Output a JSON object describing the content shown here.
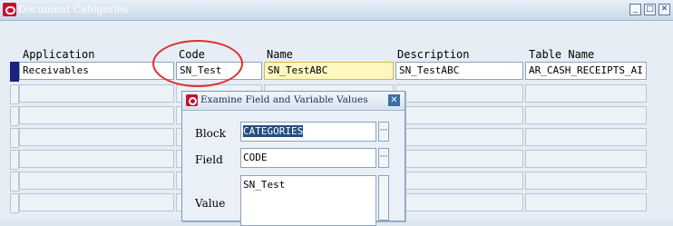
{
  "window": {
    "title": "Document Categories",
    "controls": {
      "minimize": "_",
      "maximize": "□",
      "close": "✕"
    }
  },
  "columns": [
    "Application",
    "Code",
    "Name",
    "Description",
    "Table Name"
  ],
  "record": {
    "application": "Receivables",
    "code": "SN_Test",
    "name": "SN_TestABC",
    "description": "SN_TestABC",
    "table_name": "AR_CASH_RECEIPTS_AI"
  },
  "dialog": {
    "title": "Examine Field and Variable Values",
    "block_label": "Block",
    "block_value": "CATEGORIES",
    "field_label": "Field",
    "field_value": "CODE",
    "value_label": "Value",
    "value_text": "SN_Test",
    "lov_glyph": "···",
    "close_glyph": "✕"
  },
  "colors": {
    "annotation": "#e03030",
    "current_field": "#fff7c2",
    "record_indicator": "#1a237e"
  }
}
